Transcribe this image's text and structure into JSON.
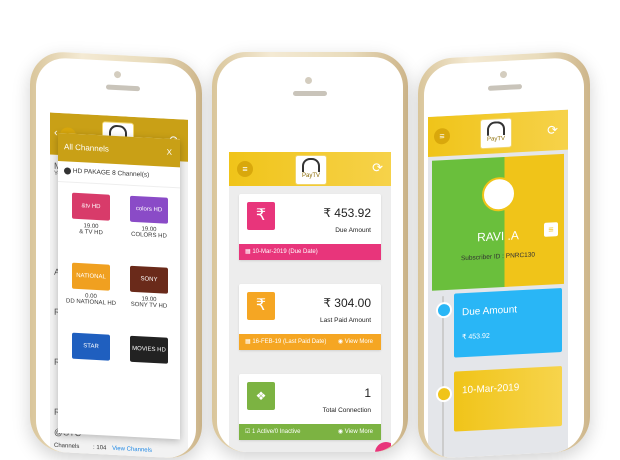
{
  "left_phone": {
    "popup_title": "All Channels",
    "close_label": "X",
    "package_label": "HD PAKAGE",
    "package_count": "8 Channel(s)",
    "channels": [
      {
        "name": "& TV HD",
        "price": "19.00",
        "logo_text": "&tv HD",
        "color": "#d83b6a"
      },
      {
        "name": "COLORS HD",
        "price": "19.00",
        "logo_text": "colors HD",
        "color": "#8a4bc7"
      },
      {
        "name": "DD NATIONAL HD",
        "price": "0.00",
        "logo_text": "NATIONAL",
        "color": "#f0a020"
      },
      {
        "name": "SONY TV HD",
        "price": "19.00",
        "logo_text": "SONY",
        "color": "#6a2a1a"
      },
      {
        "name": "",
        "price": "",
        "logo_text": "STAR WORLD HD",
        "color": "#1f5fbf"
      },
      {
        "name": "",
        "price": "",
        "logo_text": "MOVIES HD",
        "color": "#222222"
      }
    ],
    "bg_labels": [
      "M",
      "Yo",
      "Ac",
      "Re",
      "Re",
      "Re",
      "@STC"
    ],
    "channels_row_label": "Channels",
    "channels_row_value": ": 104",
    "view_channels_label": "View Channels"
  },
  "middle_phone": {
    "cards": [
      {
        "amount": "₹ 453.92",
        "label": "Due Amount",
        "footer": "10-Mar-2019 (Due Date)",
        "more": "",
        "tile_icon": "₹",
        "color": "#e8357b"
      },
      {
        "amount": "₹ 304.00",
        "label": "Last Paid Amount",
        "footer": "16-FEB-19 (Last Paid Date)",
        "more": "View More",
        "tile_icon": "₹",
        "color": "#f5a623"
      },
      {
        "amount": "1",
        "label": "Total Connection",
        "footer": "1 Active/0 Inactive",
        "more": "View More",
        "tile_icon": "dropbox-icon",
        "color": "#7cb342"
      }
    ]
  },
  "right_phone": {
    "user_name": "RAVI .A",
    "subscriber_id": "Subscriber ID : PNRC130",
    "due_title": "Due Amount",
    "due_value": "₹ 453.92",
    "date_value": "10-Mar-2019",
    "profile_colors": {
      "green": "#6abf3c",
      "yellow": "#f0c419"
    },
    "blue": "#29b6f6"
  },
  "logo": {
    "line1": "PayTV",
    "line2": "SelfCare"
  }
}
